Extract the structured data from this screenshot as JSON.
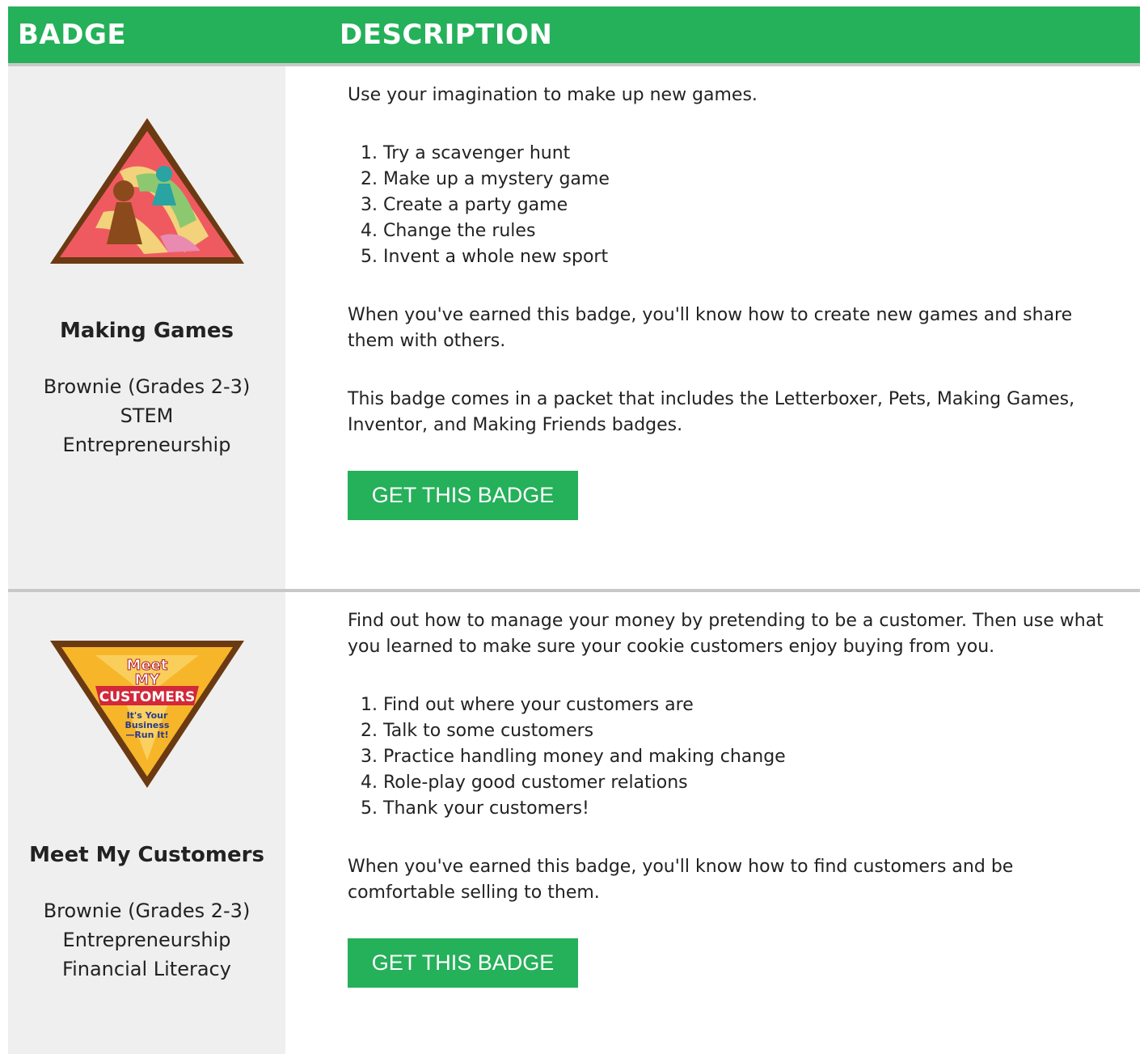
{
  "header": {
    "badge": "BADGE",
    "description": "DESCRIPTION"
  },
  "colors": {
    "brand_green": "#25b05a",
    "left_bg": "#efefef",
    "separator": "#c8c8c8"
  },
  "badges": [
    {
      "title": "Making Games",
      "image_icon": "making-games-badge-icon",
      "meta": [
        "Brownie (Grades 2-3)",
        "STEM",
        "Entrepreneurship"
      ],
      "intro": "Use your imagination to make up new games.",
      "steps": [
        "Try a scavenger hunt",
        "Make up a mystery game",
        "Create a party game",
        "Change the rules",
        "Invent a whole new sport"
      ],
      "outcome": "When you've earned this badge, you'll know how to create new games and share them with others.",
      "note": "This badge comes in a packet that includes the Letterboxer, Pets, Making Games, Inventor, and Making Friends badges.",
      "button": "GET THIS BADGE"
    },
    {
      "title": "Meet My Customers",
      "image_icon": "meet-my-customers-badge-icon",
      "image_text": {
        "line1": "Meet",
        "line2": "MY",
        "banner": "CUSTOMERS",
        "sub1": "It's Your",
        "sub2": "Business",
        "sub3": "—Run It!"
      },
      "meta": [
        "Brownie (Grades 2-3)",
        "Entrepreneurship",
        "Financial Literacy"
      ],
      "intro": "Find out how to manage your money by pretending to be a customer. Then use what you learned to make sure your cookie customers enjoy buying from you.",
      "steps": [
        "Find out where your customers are",
        "Talk to some customers",
        "Practice handling money and making change",
        "Role-play good customer relations",
        "Thank your customers!"
      ],
      "outcome": "When you've earned this badge, you'll know how to find customers and be comfortable selling to them.",
      "button": "GET THIS BADGE"
    }
  ]
}
